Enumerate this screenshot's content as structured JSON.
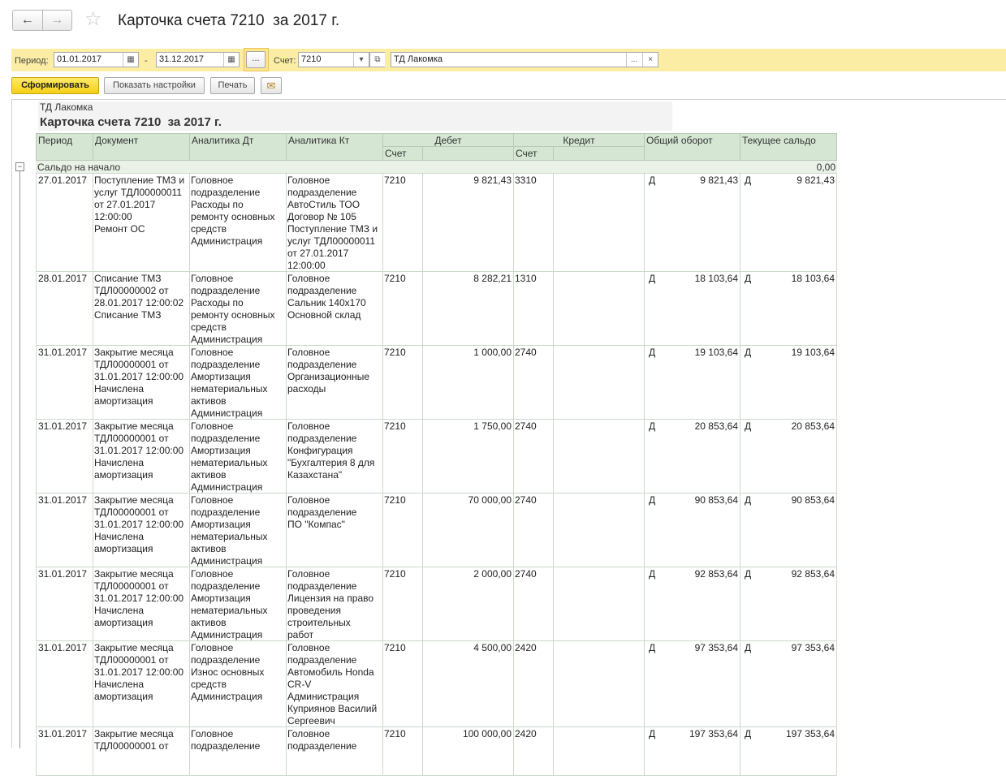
{
  "window": {
    "title": "Карточка счета 7210  за 2017 г."
  },
  "filter": {
    "period_label": "Период:",
    "date_from": "01.01.2017",
    "date_to": "31.12.2017",
    "dash": "-",
    "dots": "...",
    "account_label": "Счет:",
    "account": "7210",
    "organization": "ТД Лакомка"
  },
  "toolbar": {
    "generate": "Сформировать",
    "show_settings": "Показать настройки",
    "print": "Печать"
  },
  "report": {
    "organization": "ТД Лакомка",
    "title": "Карточка счета 7210  за 2017 г.",
    "headers": {
      "period": "Период",
      "document": "Документ",
      "analytics_dt": "Аналитика Дт",
      "analytics_kt": "Аналитика Кт",
      "debit": "Дебет",
      "credit": "Кредит",
      "account": "Счет",
      "turnover": "Общий оборот",
      "balance": "Текущее сальдо"
    },
    "opening": {
      "label": "Сальдо на начало",
      "value": "0,00"
    },
    "rows": [
      {
        "period": "27.01.2017",
        "document": "Поступление ТМЗ и\nуслуг ТДЛ00000011\nот 27.01.2017\n12:00:00\nРемонт ОС",
        "dt": "Головное\nподразделение\nРасходы по\nремонту основных\nсредств\nАдминистрация",
        "kt": "Головное\nподразделение\nАвтоСтиль ТОО\nДоговор № 105\nПоступление ТМЗ и\nуслуг ТДЛ00000011\nот 27.01.2017\n12:00:00",
        "debit_acc": "7210",
        "debit_sum": "9 821,43",
        "credit_acc": "3310",
        "credit_sum": "",
        "turn_side": "Д",
        "turn_sum": "9 821,43",
        "bal_side": "Д",
        "bal_sum": "9 821,43"
      },
      {
        "period": "28.01.2017",
        "document": "Списание ТМЗ\nТДЛ00000002 от\n28.01.2017 12:00:02\nСписание ТМЗ",
        "dt": "Головное\nподразделение\nРасходы по\nремонту основных\nсредств\nАдминистрация",
        "kt": "Головное\nподразделение\nСальник 140х170\nОсновной склад",
        "debit_acc": "7210",
        "debit_sum": "8 282,21",
        "credit_acc": "1310",
        "credit_sum": "",
        "turn_side": "Д",
        "turn_sum": "18 103,64",
        "bal_side": "Д",
        "bal_sum": "18 103,64"
      },
      {
        "period": "31.01.2017",
        "document": "Закрытие месяца\nТДЛ00000001 от\n31.01.2017 12:00:00\nНачислена\nамортизация",
        "dt": "Головное\nподразделение\nАмортизация\nнематериальных\nактивов\nАдминистрация",
        "kt": "Головное\nподразделение\nОрганизационные\nрасходы",
        "debit_acc": "7210",
        "debit_sum": "1 000,00",
        "credit_acc": "2740",
        "credit_sum": "",
        "turn_side": "Д",
        "turn_sum": "19 103,64",
        "bal_side": "Д",
        "bal_sum": "19 103,64"
      },
      {
        "period": "31.01.2017",
        "document": "Закрытие месяца\nТДЛ00000001 от\n31.01.2017 12:00:00\nНачислена\nамортизация",
        "dt": "Головное\nподразделение\nАмортизация\nнематериальных\nактивов\nАдминистрация",
        "kt": "Головное\nподразделение\nКонфигурация\n\"Бухгалтерия 8 для\nКазахстана\"",
        "debit_acc": "7210",
        "debit_sum": "1 750,00",
        "credit_acc": "2740",
        "credit_sum": "",
        "turn_side": "Д",
        "turn_sum": "20 853,64",
        "bal_side": "Д",
        "bal_sum": "20 853,64"
      },
      {
        "period": "31.01.2017",
        "document": "Закрытие месяца\nТДЛ00000001 от\n31.01.2017 12:00:00\nНачислена\nамортизация",
        "dt": "Головное\nподразделение\nАмортизация\nнематериальных\nактивов\nАдминистрация",
        "kt": "Головное\nподразделение\nПО \"Компас\"",
        "debit_acc": "7210",
        "debit_sum": "70 000,00",
        "credit_acc": "2740",
        "credit_sum": "",
        "turn_side": "Д",
        "turn_sum": "90 853,64",
        "bal_side": "Д",
        "bal_sum": "90 853,64"
      },
      {
        "period": "31.01.2017",
        "document": "Закрытие месяца\nТДЛ00000001 от\n31.01.2017 12:00:00\nНачислена\nамортизация",
        "dt": "Головное\nподразделение\nАмортизация\nнематериальных\nактивов\nАдминистрация",
        "kt": "Головное\nподразделение\nЛицензия на право\nпроведения\nстроительных\nработ",
        "debit_acc": "7210",
        "debit_sum": "2 000,00",
        "credit_acc": "2740",
        "credit_sum": "",
        "turn_side": "Д",
        "turn_sum": "92 853,64",
        "bal_side": "Д",
        "bal_sum": "92 853,64"
      },
      {
        "period": "31.01.2017",
        "document": "Закрытие месяца\nТДЛ00000001 от\n31.01.2017 12:00:00\nНачислена\nамортизация",
        "dt": "Головное\nподразделение\nИзнос основных\nсредств\nАдминистрация",
        "kt": "Головное\nподразделение\nАвтомобиль Honda\nCR-V\nАдминистрация\nКуприянов Василий\nСергеевич",
        "debit_acc": "7210",
        "debit_sum": "4 500,00",
        "credit_acc": "2420",
        "credit_sum": "",
        "turn_side": "Д",
        "turn_sum": "97 353,64",
        "bal_side": "Д",
        "bal_sum": "97 353,64"
      },
      {
        "period": "31.01.2017",
        "document": "Закрытие месяца\nТДЛ00000001 от",
        "dt": "Головное\nподразделение",
        "kt": "Головное\nподразделение",
        "debit_acc": "7210",
        "debit_sum": "100 000,00",
        "credit_acc": "2420",
        "credit_sum": "",
        "turn_side": "Д",
        "turn_sum": "197 353,64",
        "bal_side": "Д",
        "bal_sum": "197 353,64"
      }
    ]
  }
}
